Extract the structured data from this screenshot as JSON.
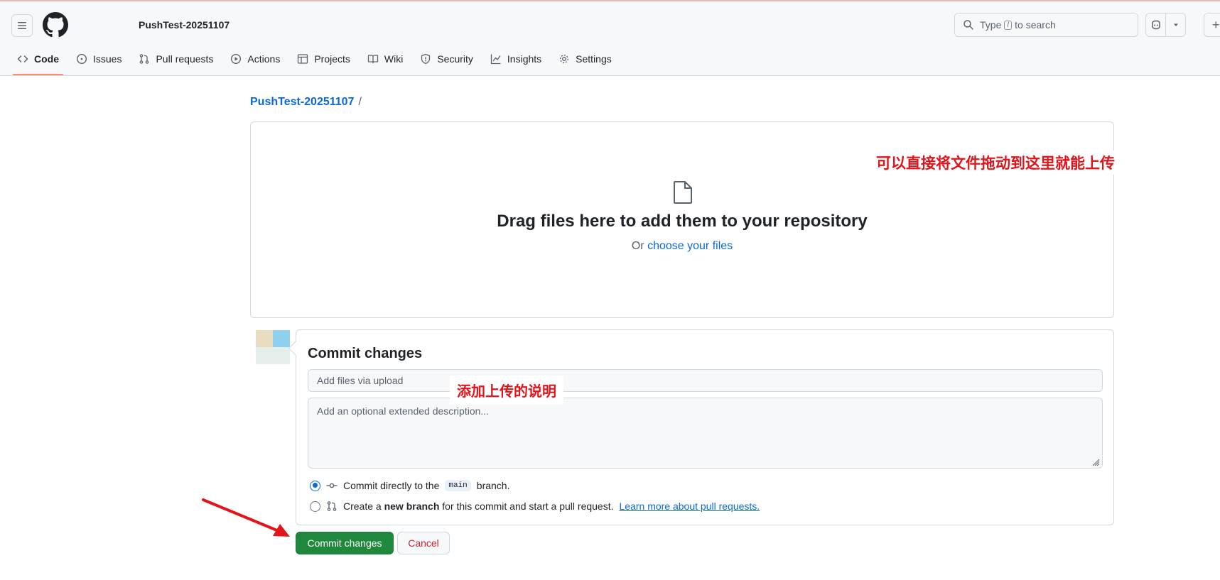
{
  "header": {
    "repo_name": "PushTest-20251107",
    "search": {
      "prefix": "Type",
      "key": "/",
      "suffix": "to search"
    },
    "tabs": [
      {
        "label": "Code",
        "icon": "code-icon",
        "active": true
      },
      {
        "label": "Issues",
        "icon": "issue-opened-icon"
      },
      {
        "label": "Pull requests",
        "icon": "git-pull-request-icon"
      },
      {
        "label": "Actions",
        "icon": "play-icon"
      },
      {
        "label": "Projects",
        "icon": "table-icon"
      },
      {
        "label": "Wiki",
        "icon": "book-icon"
      },
      {
        "label": "Security",
        "icon": "shield-icon"
      },
      {
        "label": "Insights",
        "icon": "graph-icon"
      },
      {
        "label": "Settings",
        "icon": "gear-icon"
      }
    ]
  },
  "breadcrumb": {
    "repo": "PushTest-20251107",
    "separator": "/"
  },
  "dropzone": {
    "title": "Drag files here to add them to your repository",
    "sub_prefix": "Or",
    "sub_link": "choose your files"
  },
  "commit": {
    "title": "Commit changes",
    "summary_placeholder": "Add files via upload",
    "description_placeholder": "Add an optional extended description...",
    "option_direct": {
      "prefix": "Commit directly to the",
      "branch": "main",
      "suffix": "branch."
    },
    "option_new": {
      "prefix": "Create a",
      "bold": "new branch",
      "suffix": "for this commit and start a pull request.",
      "link": "Learn more about pull requests."
    },
    "submit_label": "Commit changes",
    "cancel_label": "Cancel"
  },
  "annotations": {
    "drag_note": "可以直接将文件拖动到这里就能上传",
    "desc_note": "添加上传的说明"
  },
  "colors": {
    "primary_button": "#1f883d",
    "link": "#0969da",
    "annotation": "#e3151a",
    "active_tab_underline": "#fd8c73",
    "cancel_text": "#cf222e"
  }
}
